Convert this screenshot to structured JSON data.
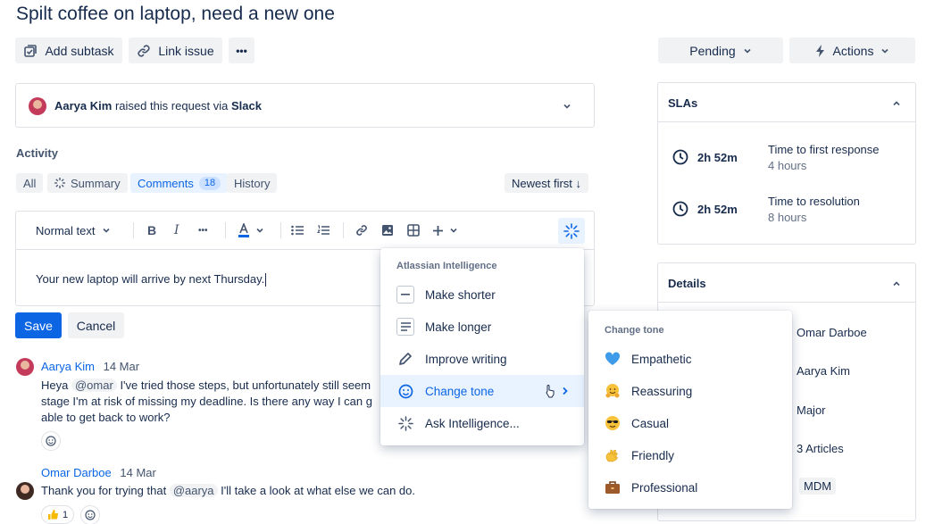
{
  "page": {
    "title": "Spilt coffee on laptop, need a new one"
  },
  "toolbar": {
    "add_subtask": "Add subtask",
    "link_issue": "Link issue",
    "more": "•••",
    "status": "Pending",
    "actions": "Actions"
  },
  "request": {
    "reporter": "Aarya Kim",
    "raised_text": "raised this request via",
    "channel": "Slack"
  },
  "activity": {
    "heading": "Activity",
    "filters": {
      "all": "All",
      "summary": "Summary",
      "comments": "Comments",
      "comments_count": "18",
      "history": "History"
    },
    "sort": "Newest first ↓"
  },
  "editor": {
    "text_style": "Normal text",
    "content": "Your new laptop will arrive by next Thursday.",
    "save": "Save",
    "cancel": "Cancel"
  },
  "ai_menu": {
    "heading": "Atlassian Intelligence",
    "items": [
      {
        "label": "Make shorter",
        "icon": "minus-icon"
      },
      {
        "label": "Make longer",
        "icon": "lines-icon"
      },
      {
        "label": "Improve writing",
        "icon": "pencil-icon"
      },
      {
        "label": "Change tone",
        "icon": "smiley-icon"
      },
      {
        "label": "Ask Intelligence...",
        "icon": "sparkle-icon"
      }
    ]
  },
  "tone_menu": {
    "heading": "Change tone",
    "items": [
      {
        "label": "Empathetic",
        "icon": "blue-heart-emoji"
      },
      {
        "label": "Reassuring",
        "icon": "hugging-face-emoji"
      },
      {
        "label": "Casual",
        "icon": "sunglasses-face-emoji"
      },
      {
        "label": "Friendly",
        "icon": "waving-hand-emoji"
      },
      {
        "label": "Professional",
        "icon": "briefcase-emoji"
      }
    ]
  },
  "comments": [
    {
      "author": "Aarya Kim",
      "date": "14 Mar",
      "line1_pre": "Heya",
      "mention": "@omar",
      "line1_post": "I've tried those steps, but unfortunately still seem",
      "line2": "stage I'm at risk of missing my deadline. Is there any way I can g",
      "line3": "able to get back to work?"
    },
    {
      "author": "Omar Darboe",
      "date": "14 Mar",
      "line1_pre": "Thank you for trying that",
      "mention": "@aarya",
      "line1_post": "I'll take a look at what else we can do.",
      "reaction_count": "1"
    }
  ],
  "slas": {
    "heading": "SLAs",
    "items": [
      {
        "time": "2h 52m",
        "label": "Time to first response",
        "goal": "4 hours"
      },
      {
        "time": "2h 52m",
        "label": "Time to resolution",
        "goal": "8 hours"
      }
    ]
  },
  "details": {
    "heading": "Details",
    "values": [
      "Omar Darboe",
      "Aarya Kim",
      "Major",
      "3 Articles",
      "MDM"
    ]
  },
  "colors": {
    "primary": "#0c66e4",
    "text": "#172b4d",
    "subtle": "#626f86"
  }
}
